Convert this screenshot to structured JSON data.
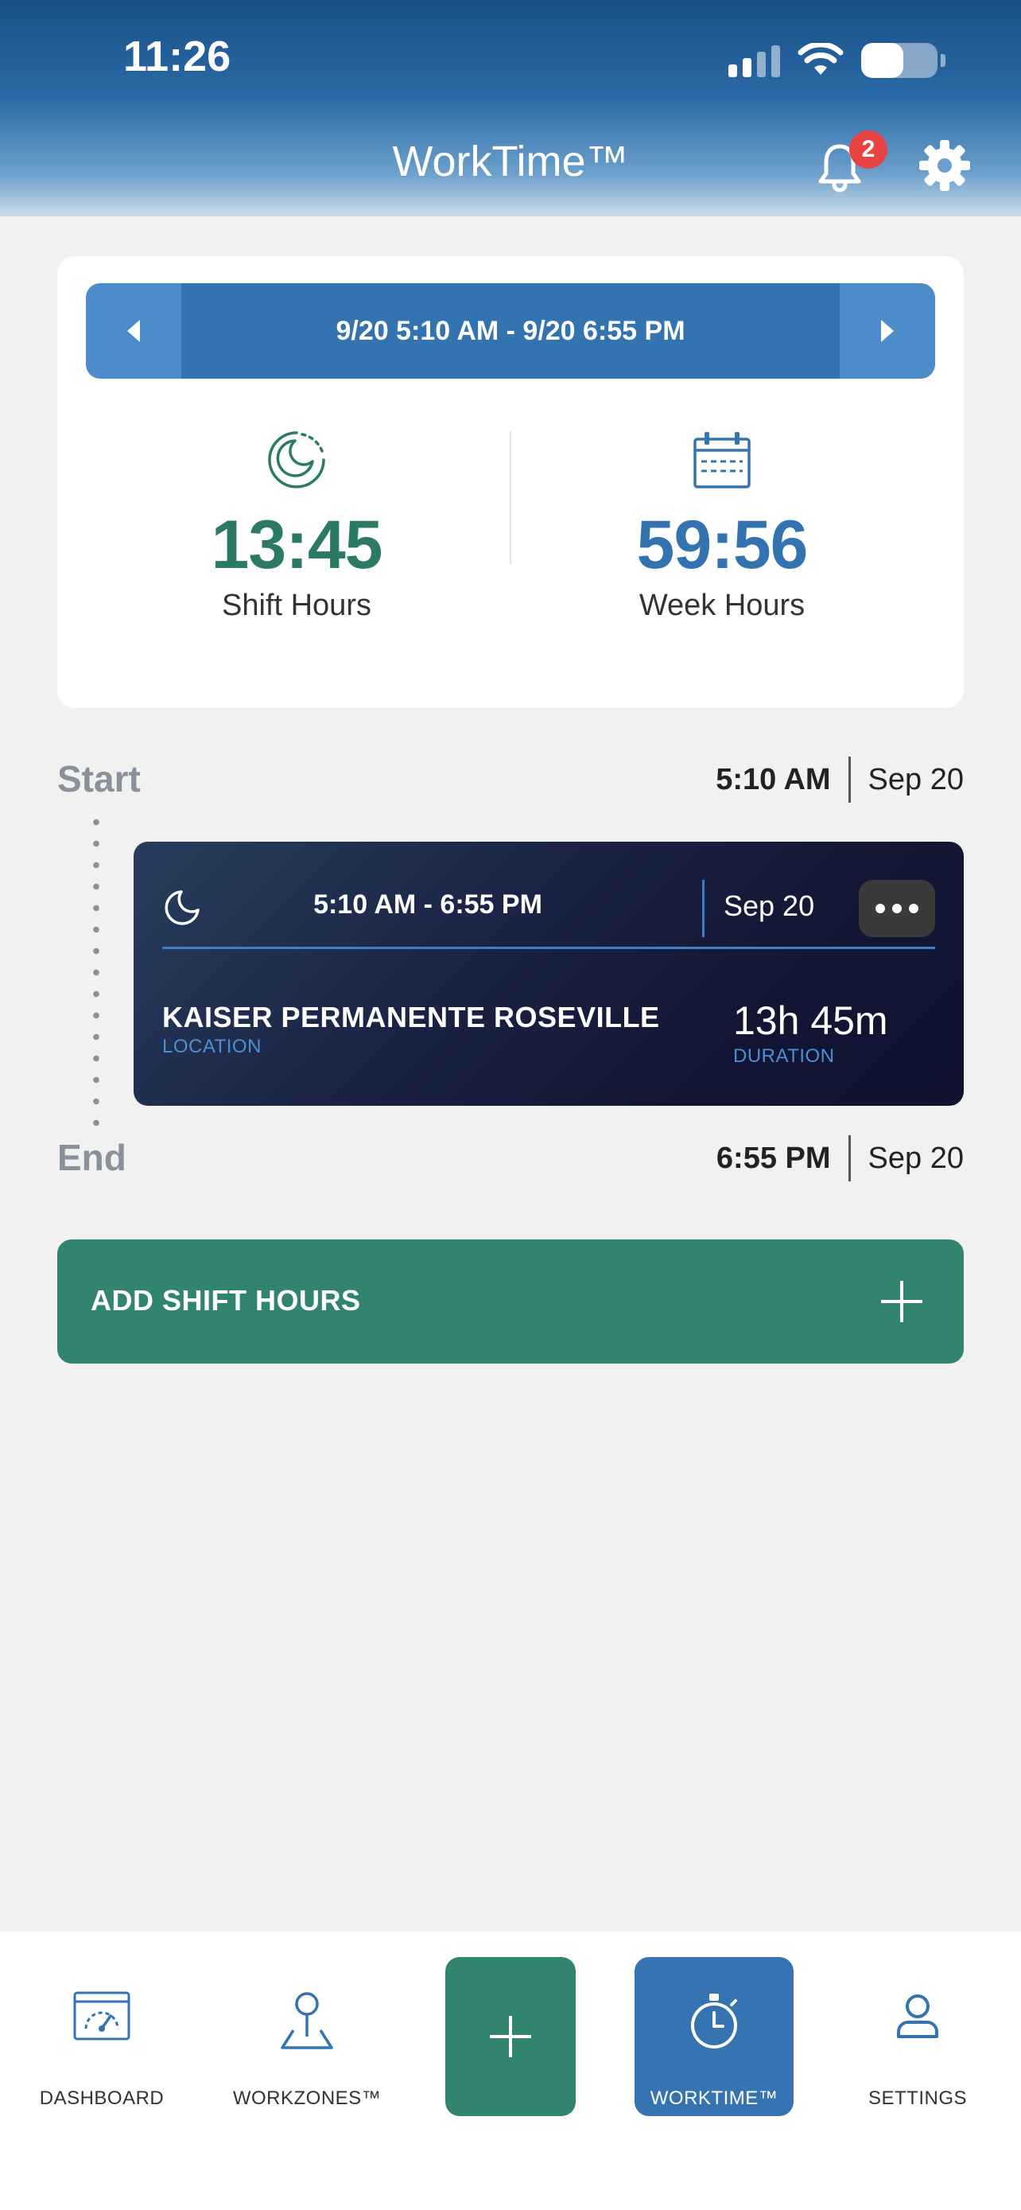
{
  "status_bar": {
    "time": "11:26"
  },
  "header": {
    "title": "WorkTime™",
    "notification_count": "2"
  },
  "summary": {
    "range": "9/20 5:10 AM - 9/20 6:55 PM",
    "shift_hours_value": "13:45",
    "shift_hours_label": "Shift Hours",
    "week_hours_value": "59:56",
    "week_hours_label": "Week Hours"
  },
  "timeline": {
    "start_label": "Start",
    "start_time": "5:10 AM",
    "start_date": "Sep 20",
    "end_label": "End",
    "end_time": "6:55 PM",
    "end_date": "Sep 20"
  },
  "shift": {
    "time_range": "5:10 AM - 6:55 PM",
    "date": "Sep 20",
    "location": "KAISER PERMANENTE ROSEVILLE",
    "location_label": "LOCATION",
    "duration": "13h 45m",
    "duration_label": "DURATION"
  },
  "add_shift_label": "ADD SHIFT HOURS",
  "nav": {
    "dashboard": "DASHBOARD",
    "workzones": "WORKZONES™",
    "worktime": "WORKTIME™",
    "settings": "SETTINGS"
  },
  "colors": {
    "shift_green": "#2b7a66",
    "week_blue": "#3273b0",
    "header_blue": "#1a5189",
    "action_green": "#318470",
    "badge_red": "#e84343"
  },
  "icons": [
    "bell-icon",
    "gear-icon",
    "moon-clock-icon",
    "calendar-icon",
    "moon-icon",
    "dashboard-icon",
    "workzones-icon",
    "stopwatch-icon",
    "user-icon"
  ]
}
